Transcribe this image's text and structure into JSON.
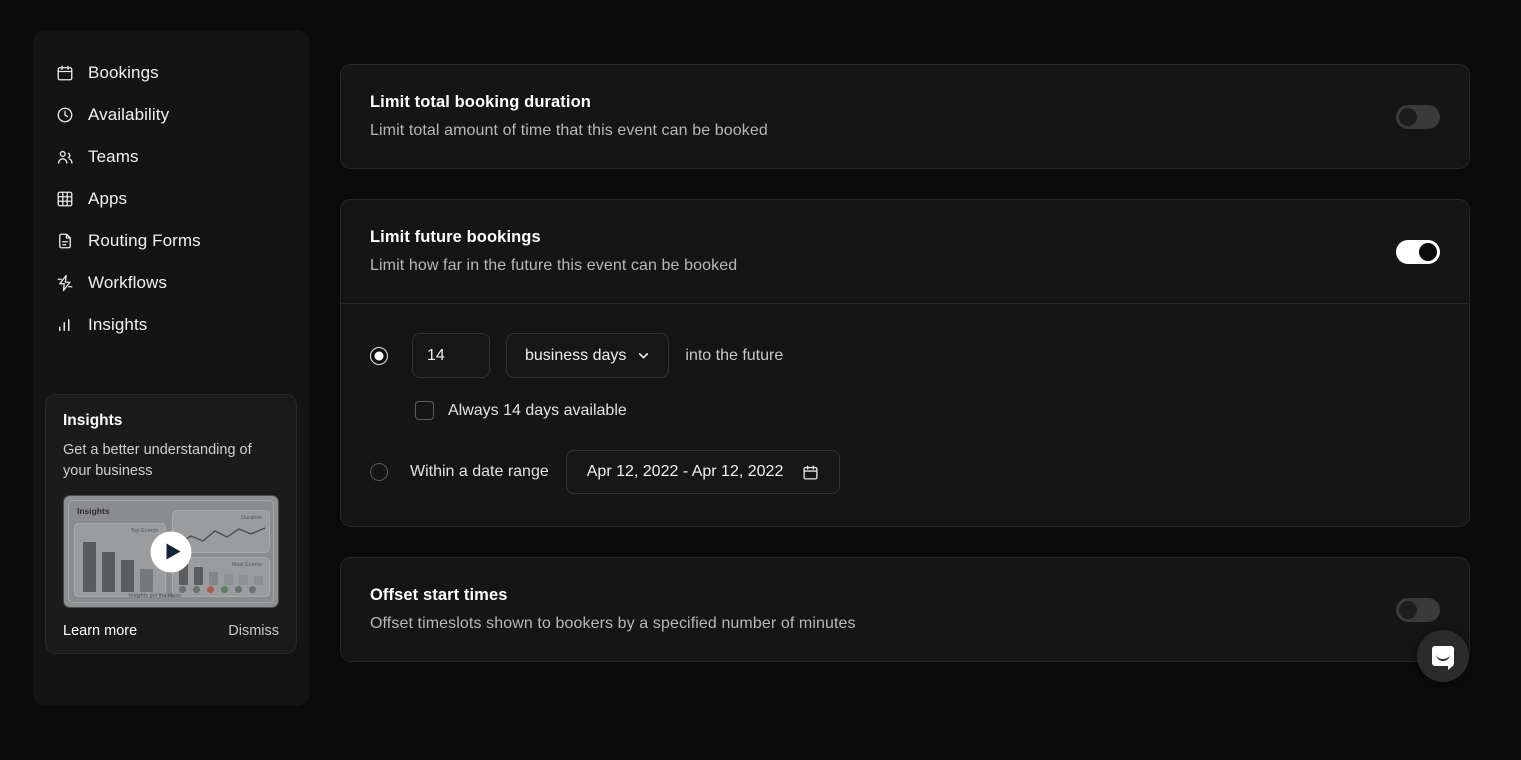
{
  "sidebar": {
    "items": [
      {
        "label": "Bookings",
        "icon": "calendar-icon"
      },
      {
        "label": "Availability",
        "icon": "clock-icon"
      },
      {
        "label": "Teams",
        "icon": "users-icon"
      },
      {
        "label": "Apps",
        "icon": "grid-icon"
      },
      {
        "label": "Routing Forms",
        "icon": "document-icon"
      },
      {
        "label": "Workflows",
        "icon": "bolt-icon"
      },
      {
        "label": "Insights",
        "icon": "bar-chart-icon"
      }
    ],
    "promo": {
      "title": "Insights",
      "description": "Get a better understanding of your business",
      "thumbnail_label": "Insights",
      "thumbnail_caption_top_events": "Top Events",
      "thumbnail_caption_duration": "Duration",
      "thumbnail_caption_most_events": "Most Events",
      "thumbnail_footer": "Insights got the ideas",
      "play_icon": "play-icon",
      "learn_more_label": "Learn more",
      "dismiss_label": "Dismiss"
    }
  },
  "main": {
    "cards": [
      {
        "title": "Limit total booking duration",
        "subtitle": "Limit total amount of time that this event can be booked",
        "toggle_state": "off"
      },
      {
        "title": "Limit future bookings",
        "subtitle": "Limit how far in the future this event can be booked",
        "toggle_state": "on"
      },
      {
        "title": "Offset start times",
        "subtitle": "Offset timeslots shown to bookers by a specified number of minutes",
        "toggle_state": "off"
      }
    ],
    "future_bookings_options": {
      "rolling": {
        "selected": true,
        "days_value": "14",
        "unit_label": "business days",
        "unit_chevron_icon": "chevron-down-icon",
        "suffix_label": "into the future",
        "always_checkbox_label": "Always 14 days available",
        "always_checkbox_checked": false
      },
      "range": {
        "selected": false,
        "label": "Within a date range",
        "date_value": "Apr 12, 2022 - Apr 12, 2022",
        "calendar_icon": "calendar-icon"
      }
    }
  },
  "intercom": {
    "icon": "chat-bubble-icon"
  },
  "colors": {
    "page_background": "#0b0b0b",
    "panel_background": "#151515",
    "sidebar_background": "#141414",
    "border": "#272727",
    "text_primary": "#ffffff",
    "text_secondary": "#b8b8b8",
    "toggle_on": "#ffffff",
    "toggle_off": "#3a3a3a"
  }
}
